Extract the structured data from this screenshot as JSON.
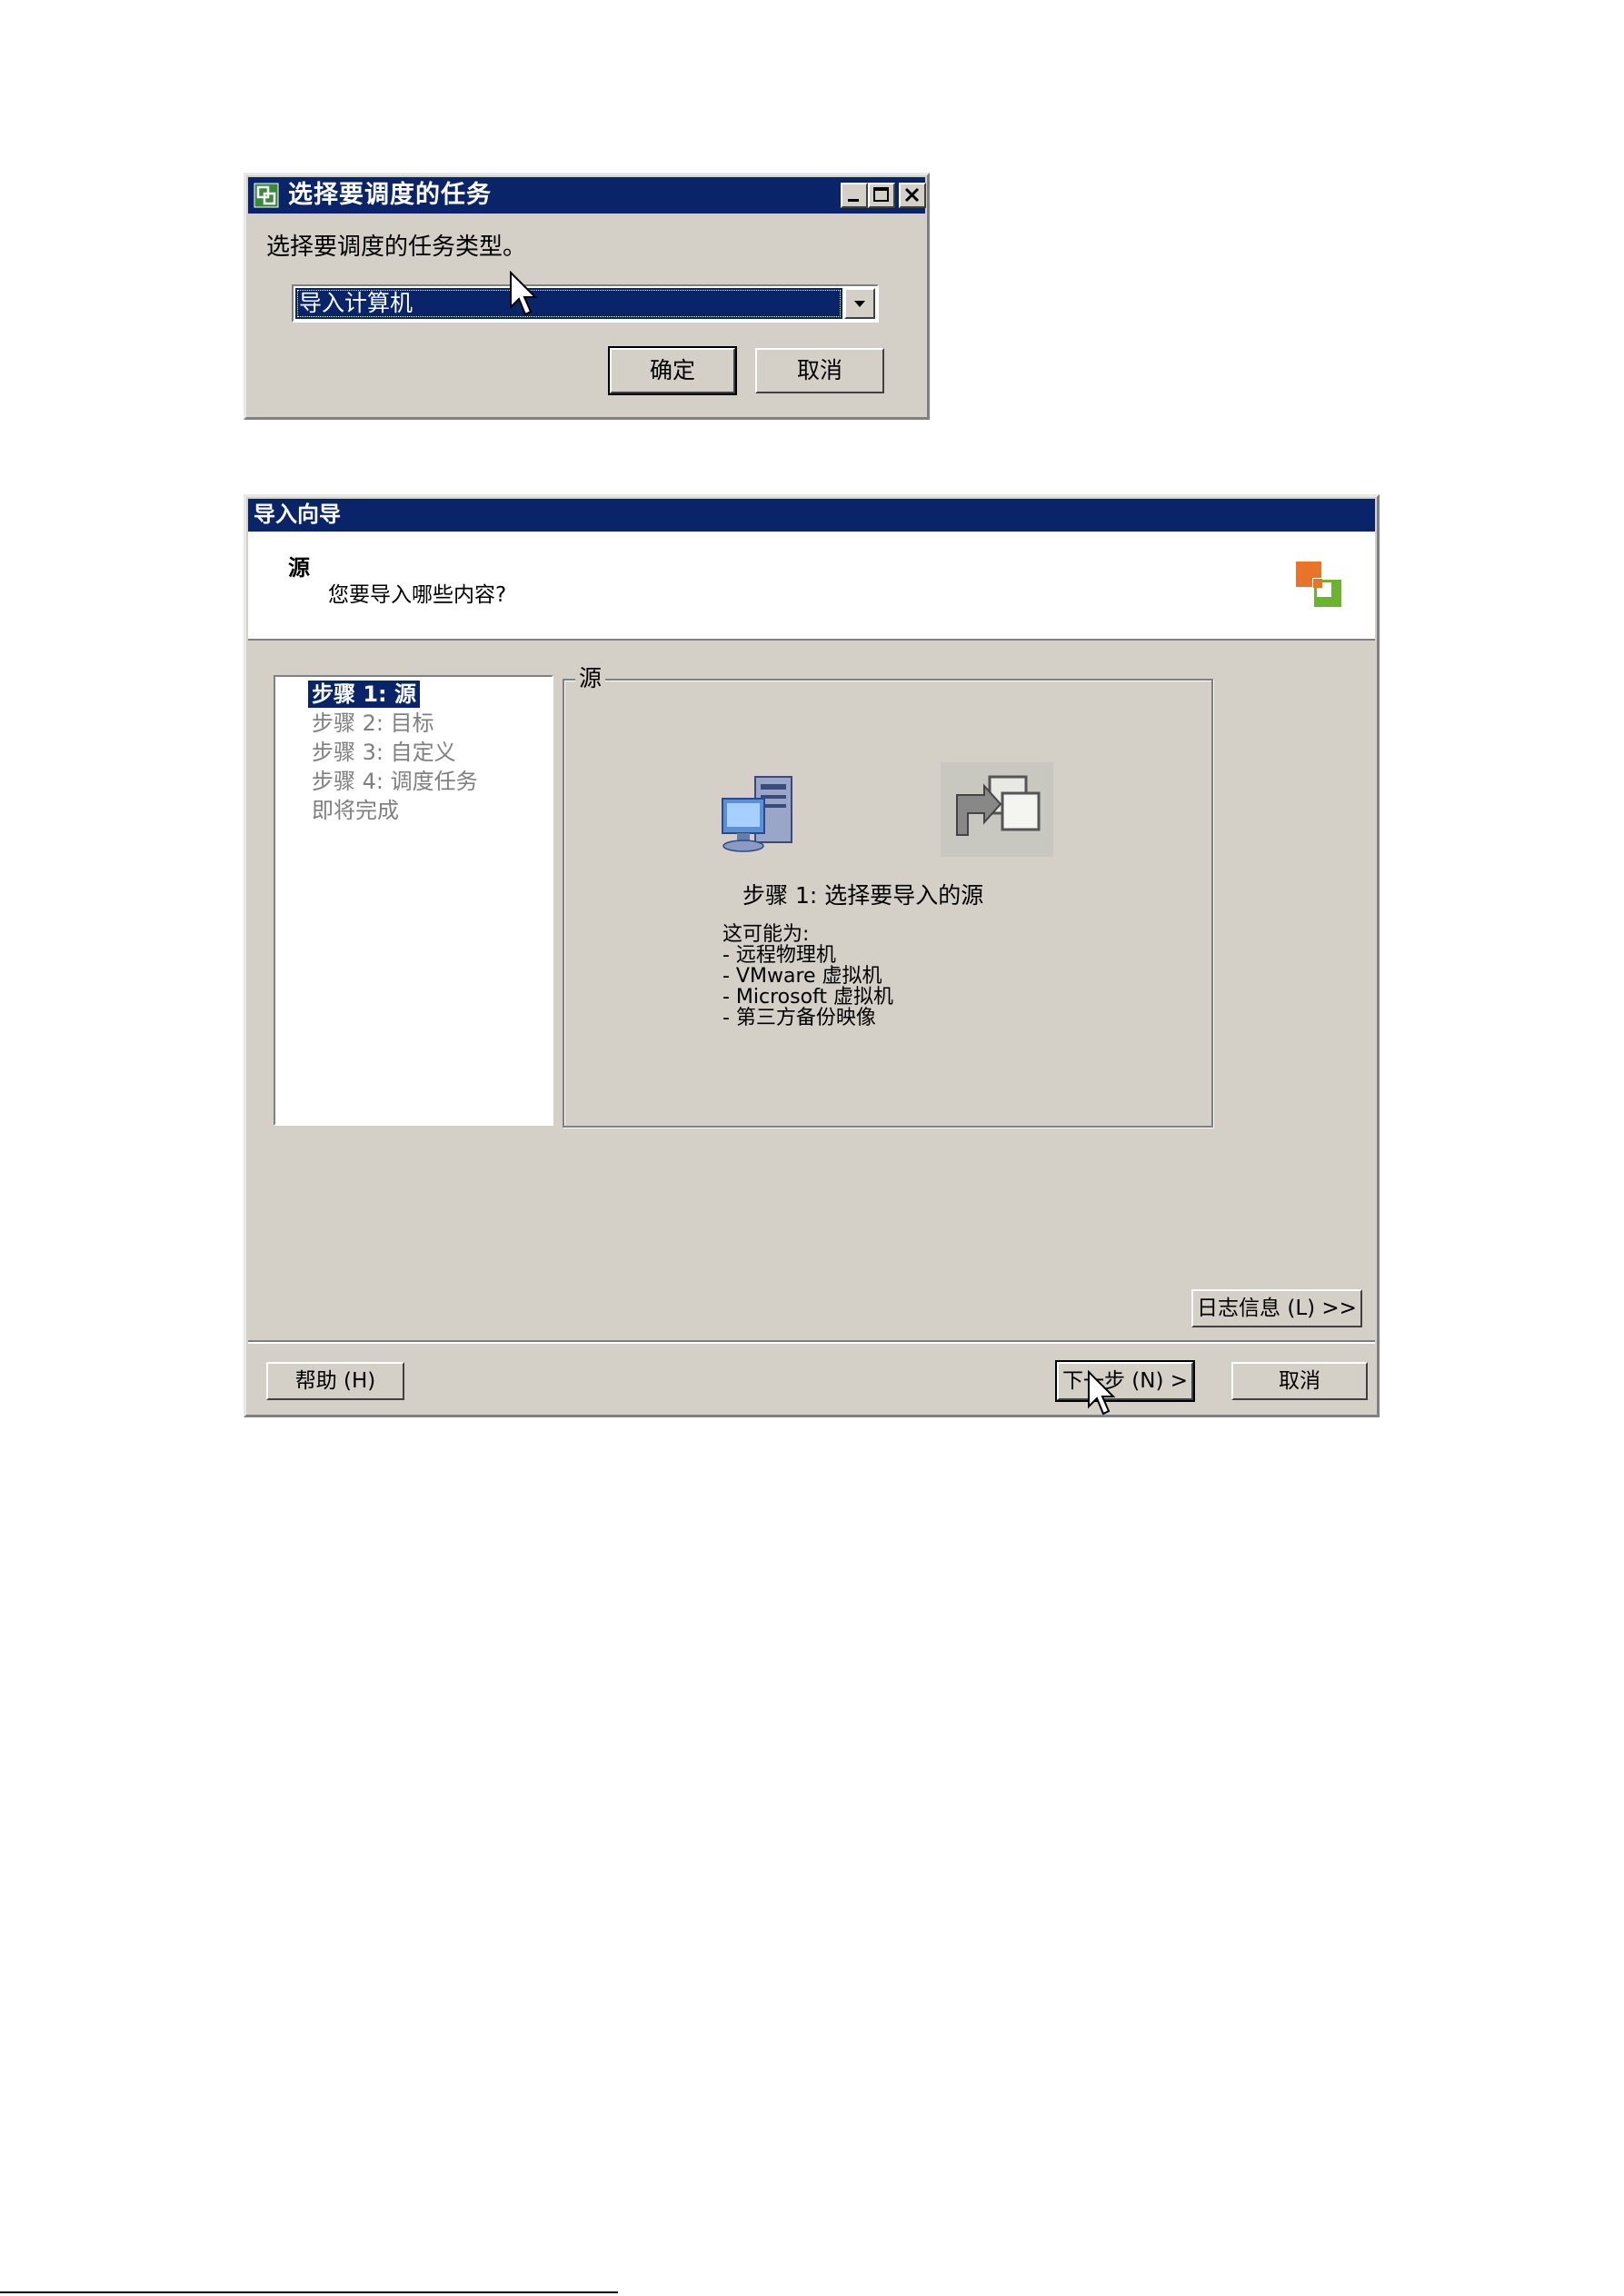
{
  "task_dialog": {
    "title": "选择要调度的任务",
    "prompt": "选择要调度的任务类型。",
    "task_type_selected": "导入计算机",
    "ok_label": "确定",
    "cancel_label": "取消"
  },
  "wizard": {
    "title": "导入向导",
    "header_title": "源",
    "header_subtitle": "您要导入哪些内容?",
    "steps": [
      "步骤 1: 源",
      "步骤 2: 目标",
      "步骤 3: 自定义",
      "步骤 4: 调度任务",
      "即将完成"
    ],
    "group_title": "源",
    "step_description": "步骤 1: 选择要导入的源",
    "note_lines": [
      "这可能为:",
      "- 远程物理机",
      "- VMware 虚拟机",
      "- Microsoft 虚拟机",
      "- 第三方备份映像"
    ],
    "log_label": "日志信息 (L) >>",
    "help_label": "帮助 (H)",
    "next_label": "下一步 (N) >",
    "cancel_label": "取消"
  },
  "colors": {
    "titlebar": "#0a246a",
    "dialog_bg": "#d4d0c8",
    "logo_orange": "#e8742a",
    "logo_green": "#6ab42e"
  },
  "icons": [
    "vmware-logo-icon",
    "minimize-icon",
    "maximize-icon",
    "close-icon",
    "dropdown-arrow-icon",
    "computer-icon",
    "import-icon",
    "mouse-cursor-icon"
  ]
}
